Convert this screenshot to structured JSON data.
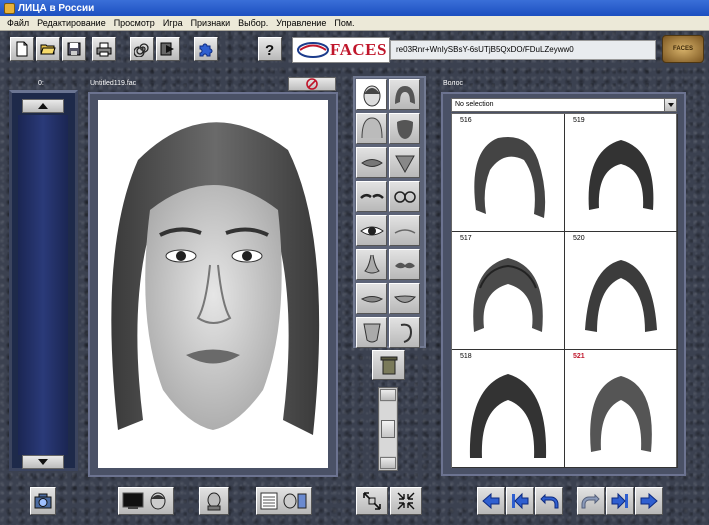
{
  "window": {
    "title": "ЛИЦА в России"
  },
  "menu": [
    "Файл",
    "Редактирование",
    "Просмотр",
    "Игра",
    "Признаки",
    "Выбор.",
    "Управление",
    "Пом."
  ],
  "toolbar": {
    "logo_text": "FACES",
    "code": "re03Rnr+WnIySBsY-6sUTjB5QxDO/FDuLZeyww0",
    "badge": "FACES"
  },
  "bin": {
    "label": "0:"
  },
  "composite": {
    "label": "Untitled119.fac"
  },
  "hair_panel": {
    "label": "Волос",
    "selection": "No selection",
    "cells": [
      {
        "num": "516",
        "highlight": false
      },
      {
        "num": "519",
        "highlight": false
      },
      {
        "num": "517",
        "highlight": false
      },
      {
        "num": "520",
        "highlight": false
      },
      {
        "num": "518",
        "highlight": false
      },
      {
        "num": "521",
        "highlight": true
      }
    ]
  },
  "feature_categories": [
    "head-shape",
    "hair",
    "forehead",
    "chin",
    "lips-top",
    "goatee",
    "eyebrows",
    "glasses",
    "eyes",
    "eye-lines",
    "nose",
    "mustache",
    "ears",
    "mouth",
    "lips-bottom",
    "jaw"
  ],
  "colors": {
    "accent_red": "#c0162b",
    "title_blue": "#1c4fc0",
    "panel_navy": "#1e2a4a"
  }
}
